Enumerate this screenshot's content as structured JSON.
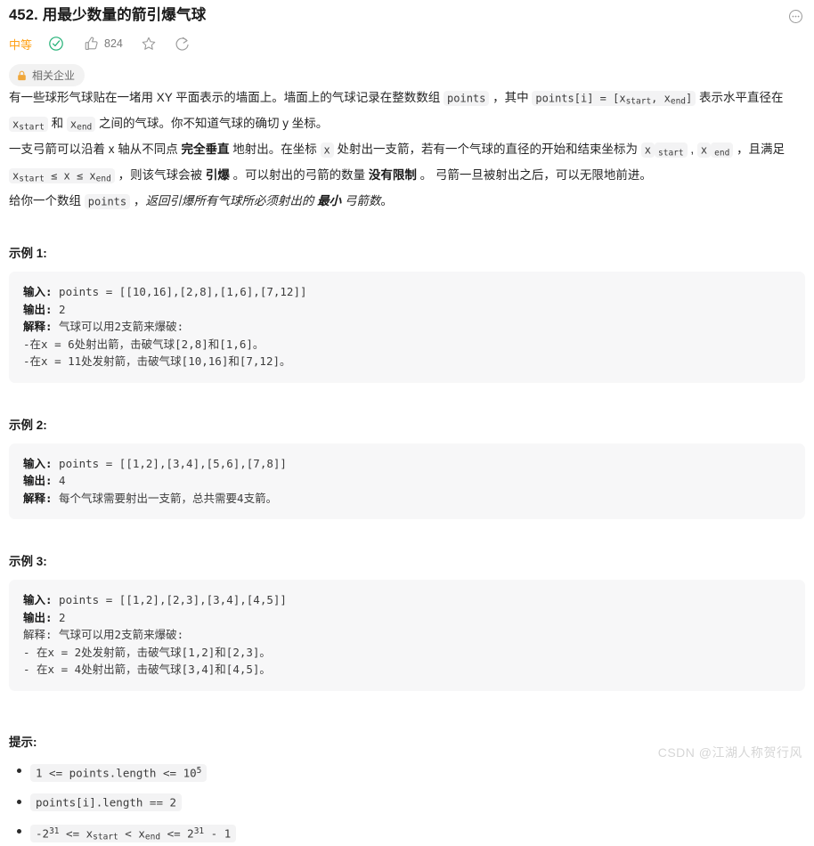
{
  "header": {
    "title": "452. 用最少数量的箭引爆气球",
    "more_icon": "more-options-circle-icon"
  },
  "meta": {
    "difficulty": "中等",
    "solved_icon": "check-circle-icon",
    "like_icon": "thumbs-up-icon",
    "like_count": "824",
    "favorite_icon": "star-outline-icon",
    "share_icon": "share-arrow-icon"
  },
  "tags": {
    "lock_icon": "lock-icon",
    "company_label": "相关企业"
  },
  "description": {
    "p1": {
      "s1": "有一些球形气球贴在一堵用 XY 平面表示的墙面上。墙面上的气球记录在整数数组 ",
      "c1": "points",
      "s2": " ，其中 ",
      "c2": "points[i] = [x",
      "c2sub": "start",
      "c2b": ", x",
      "c2sub2": "end",
      "c2c": "]",
      "s3": " 表示水平直径在 ",
      "c3": "x",
      "c3sub": "start",
      "s4": " 和 ",
      "c4": "x",
      "c4sub": "end",
      "s5": " 之间的气球。你不知道气球的确切 y 坐标。"
    },
    "p2": {
      "s1": "一支弓箭可以沿着 x 轴从不同点 ",
      "b1": "完全垂直",
      "s2": " 地射出。在坐标 ",
      "c1": "x",
      "s3": " 处射出一支箭，若有一个气球的直径的开始和结束坐标为 ",
      "c2": "x",
      "c2sub": "start",
      "s4": " , ",
      "c3": "x",
      "c3sub": "end",
      "s5": " ，且满足 ",
      "c4": "x",
      "c4sub": "start",
      "c4b": " ≤ x ≤ x",
      "c4sub2": "end",
      "s6": " ，则该气球会被 ",
      "b2": "引爆",
      "s7": " 。可以射出的弓箭的数量 ",
      "b3": "没有限制",
      "s8": " 。 弓箭一旦被射出之后，可以无限地前进。"
    },
    "p3": {
      "s1": "给你一个数组 ",
      "c1": "points",
      "s2": " ，",
      "i1": "返回引爆所有气球所必须射出的 ",
      "ib1": "最小",
      "i2": " 弓箭数",
      "s3": "。"
    }
  },
  "examples": [
    {
      "heading": "示例 1:",
      "input_label": "输入:",
      "input_value": " points = [[10,16],[2,8],[1,6],[7,12]]",
      "output_label": "输出:",
      "output_value": " 2",
      "explain_label": "解释:",
      "explain_bold": true,
      "explain_value": " 气球可以用2支箭来爆破:",
      "extra_lines": [
        "-在x = 6处射出箭，击破气球[2,8]和[1,6]。",
        "-在x = 11处发射箭，击破气球[10,16]和[7,12]。"
      ]
    },
    {
      "heading": "示例 2:",
      "input_label": "输入:",
      "input_value": " points = [[1,2],[3,4],[5,6],[7,8]]",
      "output_label": "输出:",
      "output_value": " 4",
      "explain_label": "解释:",
      "explain_bold": true,
      "explain_value": " 每个气球需要射出一支箭，总共需要4支箭。",
      "extra_lines": []
    },
    {
      "heading": "示例 3:",
      "input_label": "输入:",
      "input_value": " points = [[1,2],[2,3],[3,4],[4,5]]",
      "output_label": "输出:",
      "output_value": " 2",
      "explain_label": "解释:",
      "explain_bold": false,
      "explain_value": " 气球可以用2支箭来爆破:",
      "extra_lines": [
        "- 在x = 2处发射箭，击破气球[1,2]和[2,3]。",
        "- 在x = 4处射出箭，击破气球[3,4]和[4,5]。"
      ]
    }
  ],
  "hints": {
    "heading": "提示:",
    "items": [
      {
        "a": "1 <= points.length <= 10",
        "sup": "5",
        "b": ""
      },
      {
        "a": "points[i].length == 2",
        "sup": "",
        "b": ""
      },
      {
        "a": "-2",
        "sup": "31",
        "b": "",
        "special": "exp"
      }
    ],
    "item3": {
      "p1": "-2",
      "sup1": "31",
      "p2": " <= x",
      "sub1": "start",
      "p3": " < x",
      "sub2": "end",
      "p4": " <= 2",
      "sup2": "31",
      "p5": " - 1"
    }
  },
  "watermark": "CSDN @江湖人称贺行风",
  "colors": {
    "difficulty": "#ffa116",
    "solved": "#24b277",
    "lock": "#f0a73a",
    "code_bg": "#f3f3f4",
    "example_bg": "#f7f7f8",
    "watermark": "#d6d6d6"
  }
}
